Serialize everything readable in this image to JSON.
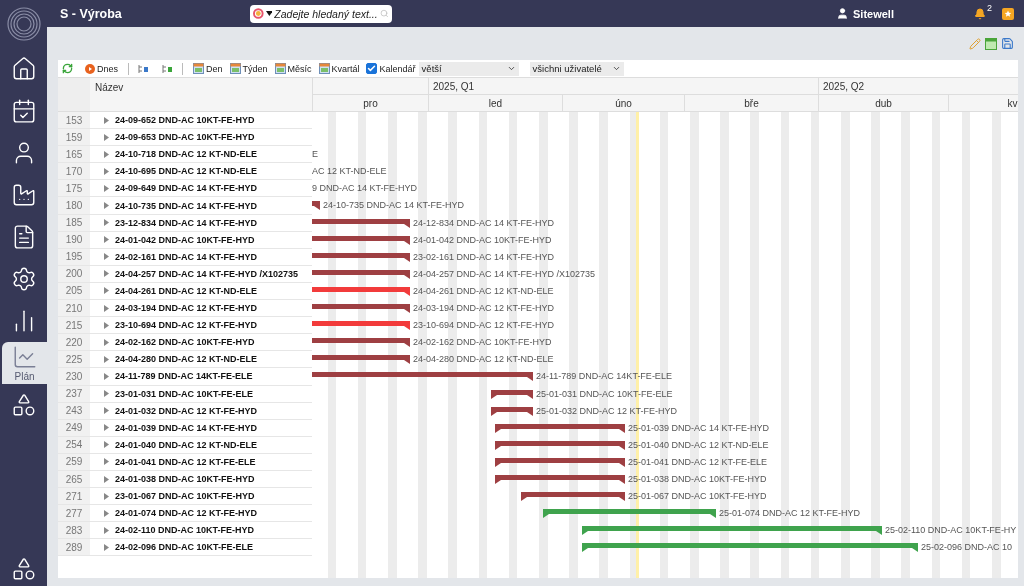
{
  "app": {
    "title": "S - Výroba",
    "search": {
      "placeholder": "Zadejte hledaný text..."
    },
    "user": "Sitewell",
    "notifications": "2"
  },
  "sidebar": {
    "items": [
      {
        "kind": "home",
        "selected": false
      },
      {
        "kind": "calendar",
        "selected": false
      },
      {
        "kind": "user",
        "selected": false
      },
      {
        "kind": "factory",
        "selected": false
      },
      {
        "kind": "document",
        "selected": false
      },
      {
        "kind": "settings",
        "selected": false
      },
      {
        "kind": "chart",
        "selected": false
      },
      {
        "kind": "plan",
        "label": "Plán",
        "selected": true
      },
      {
        "kind": "shapes",
        "selected": false
      }
    ],
    "bottom": {
      "kind": "shapes",
      "selected": false
    }
  },
  "toolbar": {
    "today": "Dnes",
    "views": [
      "Den",
      "Týden",
      "Měsíc",
      "Kvartál"
    ],
    "calendar": {
      "label": "Kalendář",
      "checked": true
    },
    "size_select": "větší",
    "user_select": "všichni uživatelé"
  },
  "table": {
    "header": "Název",
    "rows": [
      {
        "number": "153",
        "name": "24-09-652 DND-AC 10KT-FE-HYD"
      },
      {
        "number": "159",
        "name": "24-09-653 DND-AC 10KT-FE-HYD"
      },
      {
        "number": "165",
        "name": "24-10-718 DND-AC 12 KT-ND-ELE"
      },
      {
        "number": "170",
        "name": "24-10-695 DND-AC 12 KT-ND-ELE"
      },
      {
        "number": "175",
        "name": "24-09-649 DND-AC 14 KT-FE-HYD"
      },
      {
        "number": "180",
        "name": "24-10-735 DND-AC 14 KT-FE-HYD"
      },
      {
        "number": "185",
        "name": "23-12-834 DND-AC 14 KT-FE-HYD"
      },
      {
        "number": "190",
        "name": "24-01-042 DND-AC 10KT-FE-HYD"
      },
      {
        "number": "195",
        "name": "24-02-161 DND-AC 14 KT-FE-HYD"
      },
      {
        "number": "200",
        "name": "24-04-257 DND-AC 14 KT-FE-HYD /X102735"
      },
      {
        "number": "205",
        "name": "24-04-261 DND-AC 12 KT-ND-ELE"
      },
      {
        "number": "210",
        "name": "24-03-194 DND-AC 12 KT-FE-HYD"
      },
      {
        "number": "215",
        "name": "23-10-694 DND-AC 12 KT-FE-HYD"
      },
      {
        "number": "220",
        "name": "24-02-162 DND-AC 10KT-FE-HYD"
      },
      {
        "number": "225",
        "name": "24-04-280 DND-AC 12 KT-ND-ELE"
      },
      {
        "number": "230",
        "name": "24-11-789 DND-AC 14KT-FE-ELE"
      },
      {
        "number": "237",
        "name": "23-01-031 DND-AC 10KT-FE-ELE"
      },
      {
        "number": "243",
        "name": "24-01-032 DND-AC 12 KT-FE-HYD"
      },
      {
        "number": "249",
        "name": "24-01-039 DND-AC 14 KT-FE-HYD"
      },
      {
        "number": "254",
        "name": "24-01-040 DND-AC 12 KT-ND-ELE"
      },
      {
        "number": "259",
        "name": "24-01-041 DND-AC 12 KT-FE-ELE"
      },
      {
        "number": "265",
        "name": "24-01-038 DND-AC 10KT-FE-HYD"
      },
      {
        "number": "271",
        "name": "23-01-067 DND-AC 10KT-FE-HYD"
      },
      {
        "number": "277",
        "name": "24-01-074 DND-AC 12 KT-FE-HYD"
      },
      {
        "number": "283",
        "name": "24-02-110 DND-AC 10KT-FE-HYD"
      },
      {
        "number": "289",
        "name": "24-02-096 DND-AC 10KT-FE-ELE"
      }
    ]
  },
  "timeline": {
    "quarters": [
      "2025, Q1",
      "2025, Q2"
    ],
    "months": [
      "pro",
      "led",
      "úno",
      "bře",
      "dub",
      "kv"
    ]
  },
  "gantt": [
    {
      "label": "E"
    },
    {
      "label": "AC 12 KT-ND-ELE"
    },
    {
      "label": "9 DND-AC 14 KT-FE-HYD"
    },
    {
      "label": "24-10-735 DND-AC 14 KT-FE-HYD",
      "color": "#9e3f42"
    },
    {
      "label": "24-12-834 DND-AC 14 KT-FE-HYD",
      "color": "#9e3f42"
    },
    {
      "label": "24-01-042 DND-AC 10KT-FE-HYD",
      "color": "#9e3f42"
    },
    {
      "label": "23-02-161 DND-AC 14 KT-FE-HYD",
      "color": "#9e3f42"
    },
    {
      "label": "24-04-257 DND-AC 14 KT-FE-HYD /X102735",
      "color": "#9e3f42"
    },
    {
      "label": "24-04-261 DND-AC 12 KT-ND-ELE",
      "color": "#f23b3b"
    },
    {
      "label": "24-03-194 DND-AC 12 KT-FE-HYD",
      "color": "#9e3f42"
    },
    {
      "label": "23-10-694 DND-AC 12 KT-FE-HYD",
      "color": "#f23b3b"
    },
    {
      "label": "24-02-162 DND-AC 10KT-FE-HYD",
      "color": "#9e3f42"
    },
    {
      "label": "24-04-280 DND-AC 12 KT-ND-ELE",
      "color": "#9e3f42"
    },
    {
      "label": "24-11-789 DND-AC 14KT-FE-ELE",
      "color": "#9e3f42"
    },
    {
      "label": "25-01-031 DND-AC 10KT-FE-ELE",
      "color": "#9e3f42"
    },
    {
      "label": "25-01-032 DND-AC 12 KT-FE-HYD",
      "color": "#9e3f42"
    },
    {
      "label": "25-01-039 DND-AC 14 KT-FE-HYD",
      "color": "#9e3f42"
    },
    {
      "label": "25-01-040 DND-AC 12 KT-ND-ELE",
      "color": "#9e3f42"
    },
    {
      "label": "25-01-041 DND-AC 12 KT-FE-ELE",
      "color": "#9e3f42"
    },
    {
      "label": "25-01-038 DND-AC 10KT-FE-HYD",
      "color": "#9e3f42"
    },
    {
      "label": "25-01-067 DND-AC 10KT-FE-HYD",
      "color": "#9e3f42"
    },
    {
      "label": "25-01-074 DND-AC 12 KT-FE-HYD",
      "color": "#3fa34d"
    },
    {
      "label": "25-02-110 DND-AC 10KT-FE-HY",
      "color": "#3fa34d"
    },
    {
      "label": "25-02-096 DND-AC 10",
      "color": "#3fa34d"
    }
  ]
}
